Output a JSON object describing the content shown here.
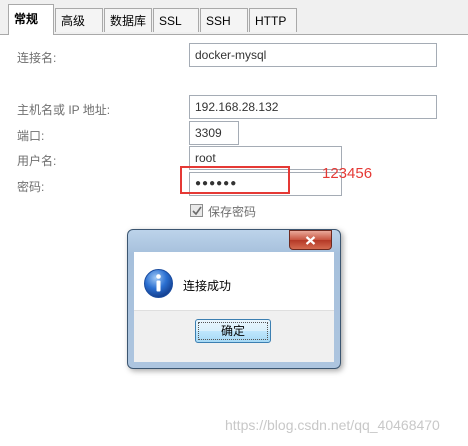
{
  "tabs": [
    {
      "label": "常规",
      "active": true
    },
    {
      "label": "高级"
    },
    {
      "label": "数据库"
    },
    {
      "label": "SSL"
    },
    {
      "label": "SSH"
    },
    {
      "label": "HTTP"
    }
  ],
  "form": {
    "connection_name": {
      "label": "连接名:",
      "value": "docker-mysql"
    },
    "host": {
      "label": "主机名或 IP 地址:",
      "value": "192.168.28.132"
    },
    "port": {
      "label": "端口:",
      "value": "3309"
    },
    "username": {
      "label": "用户名:",
      "value": "root"
    },
    "password": {
      "label": "密码:",
      "value": "●●●●●●"
    },
    "save_password": {
      "label": "保存密码",
      "checked": true
    }
  },
  "annotation": {
    "text": "123456",
    "color": "#e53935"
  },
  "dialog": {
    "message": "连接成功",
    "ok_label": "确定",
    "icon": "info-icon"
  },
  "watermark": "https://blog.csdn.net/qq_40468470"
}
